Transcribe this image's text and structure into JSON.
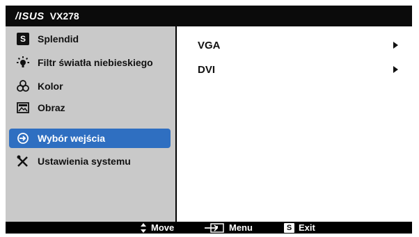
{
  "title": {
    "brand": "/ISUS",
    "model": "VX278"
  },
  "menu": [
    {
      "label": "Splendid",
      "icon": "splendid-s-icon"
    },
    {
      "label": "Filtr światła niebieskiego",
      "icon": "blue-light-bulb-icon"
    },
    {
      "label": "Kolor",
      "icon": "color-rgb-icon"
    },
    {
      "label": "Obraz",
      "icon": "image-icon"
    },
    {
      "label": "Wybór wejścia",
      "icon": "input-select-icon",
      "selected": true
    },
    {
      "label": "Ustawienia systemu",
      "icon": "tools-icon"
    }
  ],
  "submenu": [
    {
      "label": "VGA"
    },
    {
      "label": "DVI"
    }
  ],
  "footer": {
    "move": "Move",
    "menu": "Menu",
    "exit": "Exit",
    "exit_key": "S"
  },
  "colors": {
    "selected_bg": "#2f6fc1",
    "left_panel": "#c9c9c9",
    "frame": "#000000"
  }
}
